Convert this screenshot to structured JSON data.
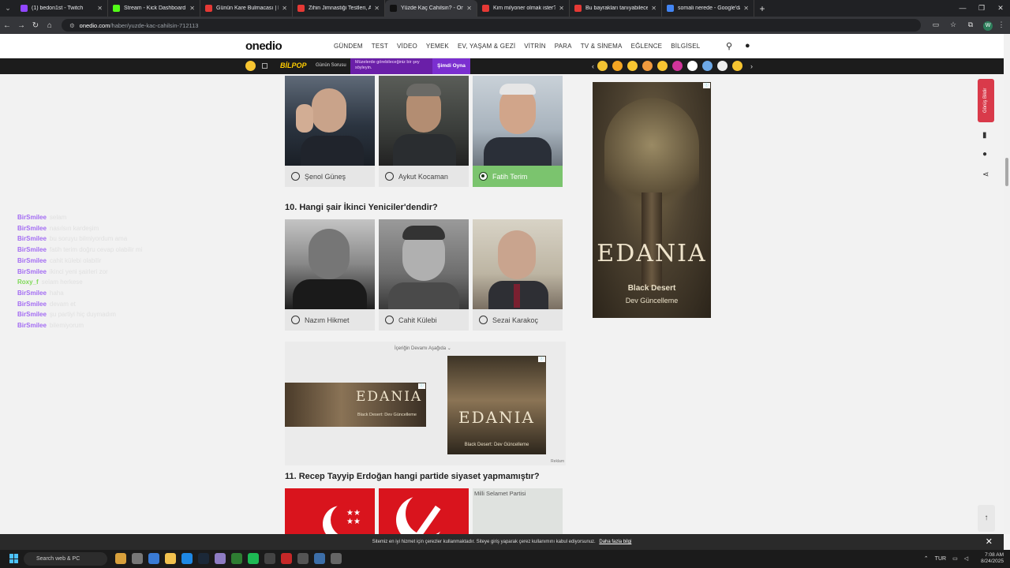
{
  "browser": {
    "tabs": [
      {
        "title": "(1) bedon1st - Twitch",
        "color": "#9146ff"
      },
      {
        "title": "Stream - Kick Dashboard",
        "color": "#53fc18"
      },
      {
        "title": "Günün Kare Bulmacası | HT Bul",
        "color": "#e53935"
      },
      {
        "title": "Zihin Jimnastiği Testleri, Akıl &",
        "color": "#e53935"
      },
      {
        "title": "Yüzde Kaç Cahilsin? - Onedio",
        "color": "#111111",
        "active": true
      },
      {
        "title": "Kim milyoner olmak ister?",
        "color": "#e53935"
      },
      {
        "title": "Bu bayrakları tanıyabilecek mis",
        "color": "#e53935"
      },
      {
        "title": "somali nerede - Google'da Ara",
        "color": "#4285f4"
      }
    ],
    "url_host": "onedio.com",
    "url_path": "/haber/yuzde-kac-cahilsin-712113",
    "profile_initial": "W"
  },
  "site": {
    "logo": "onedio",
    "nav": [
      "GÜNDEM",
      "TEST",
      "VİDEO",
      "YEMEK",
      "EV, YAŞAM & GEZİ",
      "VİTRİN",
      "PARA",
      "TV & SİNEMA",
      "EĞLENCE",
      "BİLGİSEL"
    ]
  },
  "subbar": {
    "bilpop": "BİLPOP",
    "gunun": "Günün Sorusu",
    "promo": "Müzelerde görebileceğiniz bir şey söyleyin.",
    "play": "Şimdi Oyna"
  },
  "quiz": {
    "q9_options": [
      {
        "name": "Şenol Güneş",
        "selected": false
      },
      {
        "name": "Aykut Kocaman",
        "selected": false
      },
      {
        "name": "Fatih Terim",
        "selected": true
      }
    ],
    "q10_title": "10. Hangi şair İkinci Yeniciler'dendir?",
    "q10_options": [
      {
        "name": "Nazım Hikmet"
      },
      {
        "name": "Cahit Külebi"
      },
      {
        "name": "Sezai Karakoç"
      }
    ],
    "continue_label": "İçeriğin Devamı Aşağıda",
    "ad_label": "Reklam",
    "q11_title": "11. Recep Tayyip Erdoğan hangi partide siyaset yapmamıştır?",
    "q11_broken_image": "Milli Selamet Partisi"
  },
  "ads": {
    "title": "EDANIA",
    "subtitle": "Black Desert",
    "update": "Dev Güncelleme",
    "update_short": "Dev Güncelleme"
  },
  "chat": [
    {
      "user": "BirSmilee",
      "msg": "selam",
      "color": "#a36cf3"
    },
    {
      "user": "BirSmilee",
      "msg": "nasılsın kardeşim",
      "color": "#a36cf3"
    },
    {
      "user": "BirSmilee",
      "msg": "bu soruyu bilmiyordum ama",
      "color": "#a36cf3"
    },
    {
      "user": "BirSmilee",
      "msg": "fatih terim doğru cevap olabilir mi",
      "color": "#a36cf3"
    },
    {
      "user": "BirSmilee",
      "msg": "cahit külebi olabilir",
      "color": "#a36cf3"
    },
    {
      "user": "BirSmilee",
      "msg": "ikinci yeni şairleri zor",
      "color": "#a36cf3"
    },
    {
      "user": "Roxy_f",
      "msg": "selam herkese",
      "color": "#7ed957"
    },
    {
      "user": "BirSmilee",
      "msg": "haha",
      "color": "#a36cf3"
    },
    {
      "user": "BirSmilee",
      "msg": "devam et",
      "color": "#a36cf3"
    },
    {
      "user": "BirSmilee",
      "msg": "şu partiyi hiç duymadım",
      "color": "#a36cf3"
    },
    {
      "user": "BirSmilee",
      "msg": "bilemiyorum",
      "color": "#a36cf3"
    }
  ],
  "rail": {
    "red_tab": "Görüş Bildir"
  },
  "cookie": {
    "text": "Sitemiz en iyi hizmet için çerezler kullanmaktadır. Siteye giriş yaparak çerez kullanımını kabul ediyorsunuz.",
    "link": "Daha fazla bilgi"
  },
  "taskbar": {
    "search": "Search web & PC",
    "lang": "TUR",
    "time": "7:08 AM",
    "date": "8/24/2025"
  }
}
